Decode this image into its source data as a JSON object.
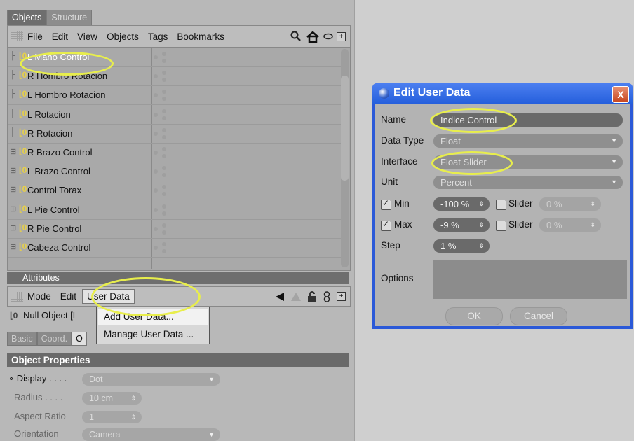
{
  "objects_panel": {
    "tabs": [
      "Objects",
      "Structure"
    ],
    "menu": [
      "File",
      "Edit",
      "View",
      "Objects",
      "Tags",
      "Bookmarks"
    ],
    "items": [
      {
        "label": "L Mano Control",
        "expandable": false
      },
      {
        "label": "R Hombro Rotacion",
        "expandable": false
      },
      {
        "label": "L Hombro Rotacion",
        "expandable": false
      },
      {
        "label": "L Rotacion",
        "expandable": false
      },
      {
        "label": "R Rotacion",
        "expandable": false
      },
      {
        "label": "R Brazo Control",
        "expandable": true
      },
      {
        "label": "L Brazo Control",
        "expandable": true
      },
      {
        "label": "Control Torax",
        "expandable": true
      },
      {
        "label": "L Pie Control",
        "expandable": true
      },
      {
        "label": "R Pie Control",
        "expandable": true
      },
      {
        "label": "Cabeza Control",
        "expandable": true
      }
    ]
  },
  "attributes_panel": {
    "title": "Attributes",
    "menu": [
      "Mode",
      "Edit",
      "User Data"
    ],
    "object_label": "Null Object [L",
    "user_data_menu": [
      "Add User Data...",
      "Manage User Data ..."
    ],
    "tabs": [
      "Basic",
      "Coord.",
      "O"
    ],
    "section": "Object Properties",
    "props": {
      "display_label": "Display . . . .",
      "display_value": "Dot",
      "radius_label": "Radius . . . .",
      "radius_value": "10 cm",
      "aspect_label": "Aspect Ratio",
      "aspect_value": "1",
      "orientation_label": "Orientation",
      "orientation_value": "Camera"
    }
  },
  "dialog": {
    "title": "Edit User Data",
    "close": "X",
    "labels": {
      "name": "Name",
      "data_type": "Data Type",
      "interface": "Interface",
      "unit": "Unit",
      "min": "Min",
      "max": "Max",
      "step": "Step",
      "options": "Options",
      "slider": "Slider"
    },
    "values": {
      "name": "Indice Control",
      "data_type": "Float",
      "interface": "Float Slider",
      "unit": "Percent",
      "min": "-100 %",
      "min_slider": "0 %",
      "max": "-9 %",
      "max_slider": "0 %",
      "step": "1 %"
    },
    "buttons": {
      "ok": "OK",
      "cancel": "Cancel"
    }
  },
  "colors": {
    "highlight": "#e8ee4c",
    "dialog_frame": "#2b59d8"
  }
}
